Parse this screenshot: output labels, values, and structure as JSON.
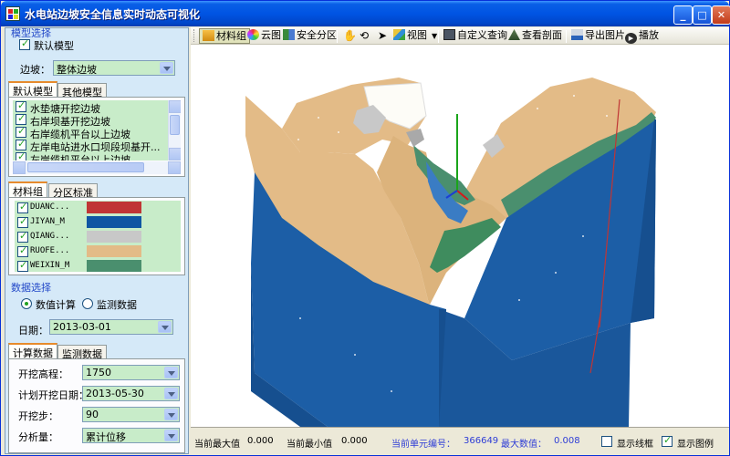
{
  "window": {
    "title": "水电站边坡安全信息实时动态可视化",
    "minimize": "_",
    "maximize": "□",
    "close": "✕"
  },
  "model_select": {
    "title": "模型选择",
    "default_model_label": "默认模型",
    "default_model_checked": true,
    "slope_label": "边坡：",
    "slope_value": "整体边坡"
  },
  "model_tabs": {
    "tabs": [
      "默认模型",
      "其他模型"
    ],
    "active": 0,
    "items": [
      {
        "label": "水垫塘开挖边坡",
        "checked": true
      },
      {
        "label": "右岸坝基开挖边坡",
        "checked": true
      },
      {
        "label": "右岸缆机平台以上边坡",
        "checked": true
      },
      {
        "label": "左岸电站进水口坝段坝基开...",
        "checked": true
      },
      {
        "label": "左岸缆机平台以上边坡",
        "checked": true
      }
    ]
  },
  "material_tabs": {
    "tabs": [
      "材料组",
      "分区标准"
    ],
    "active": 0,
    "items": [
      {
        "label": "DUANC...",
        "checked": true,
        "color": "#c03535"
      },
      {
        "label": "JIYAN_M",
        "checked": true,
        "color": "#0f56a3"
      },
      {
        "label": "QIANG...",
        "checked": true,
        "color": "#c8c8c8"
      },
      {
        "label": "RUOFE...",
        "checked": true,
        "color": "#e3bb87"
      },
      {
        "label": "WEIXIN_M",
        "checked": true,
        "color": "#4a8f6e"
      }
    ]
  },
  "data_select": {
    "title": "数据选择",
    "options": [
      "数值计算",
      "监测数据"
    ],
    "selected": 0,
    "date_label": "日期：",
    "date_value": "2013-03-01"
  },
  "calc_tabs": {
    "tabs": [
      "计算数据",
      "监测数据"
    ],
    "active": 0,
    "fields": [
      {
        "label": "开挖高程：",
        "value": "1750"
      },
      {
        "label": "计划开挖日期：",
        "value": "2013-05-30"
      },
      {
        "label": "开挖步：",
        "value": "90"
      },
      {
        "label": "分析量：",
        "value": "累计位移"
      }
    ]
  },
  "toolbar": {
    "material_group": "材料组",
    "cloud": "云图",
    "safety_zone": "安全分区",
    "view": "视图",
    "custom_query": "自定义查询",
    "view_section": "查看剖面",
    "export_image": "导出图片",
    "play": "播放"
  },
  "status": {
    "cur_max_label": "当前最大值",
    "cur_max_value": "0.000",
    "cur_min_label": "当前最小值",
    "cur_min_value": "0.000",
    "unit_label": "当前单元编号：",
    "unit_value": "366649",
    "max_label": "最大数值：",
    "max_value": "0.008",
    "show_wireframe": "显示线框",
    "show_wireframe_checked": false,
    "show_legend": "显示图例",
    "show_legend_checked": true
  },
  "colors": {
    "rock_blue": "#1c5ea6",
    "rock_side": "#164f8f",
    "sand": "#e3bb87",
    "teal": "#4a8f6e",
    "panel_bg": "#d5e9f8",
    "list_green": "#c8ecc9"
  }
}
